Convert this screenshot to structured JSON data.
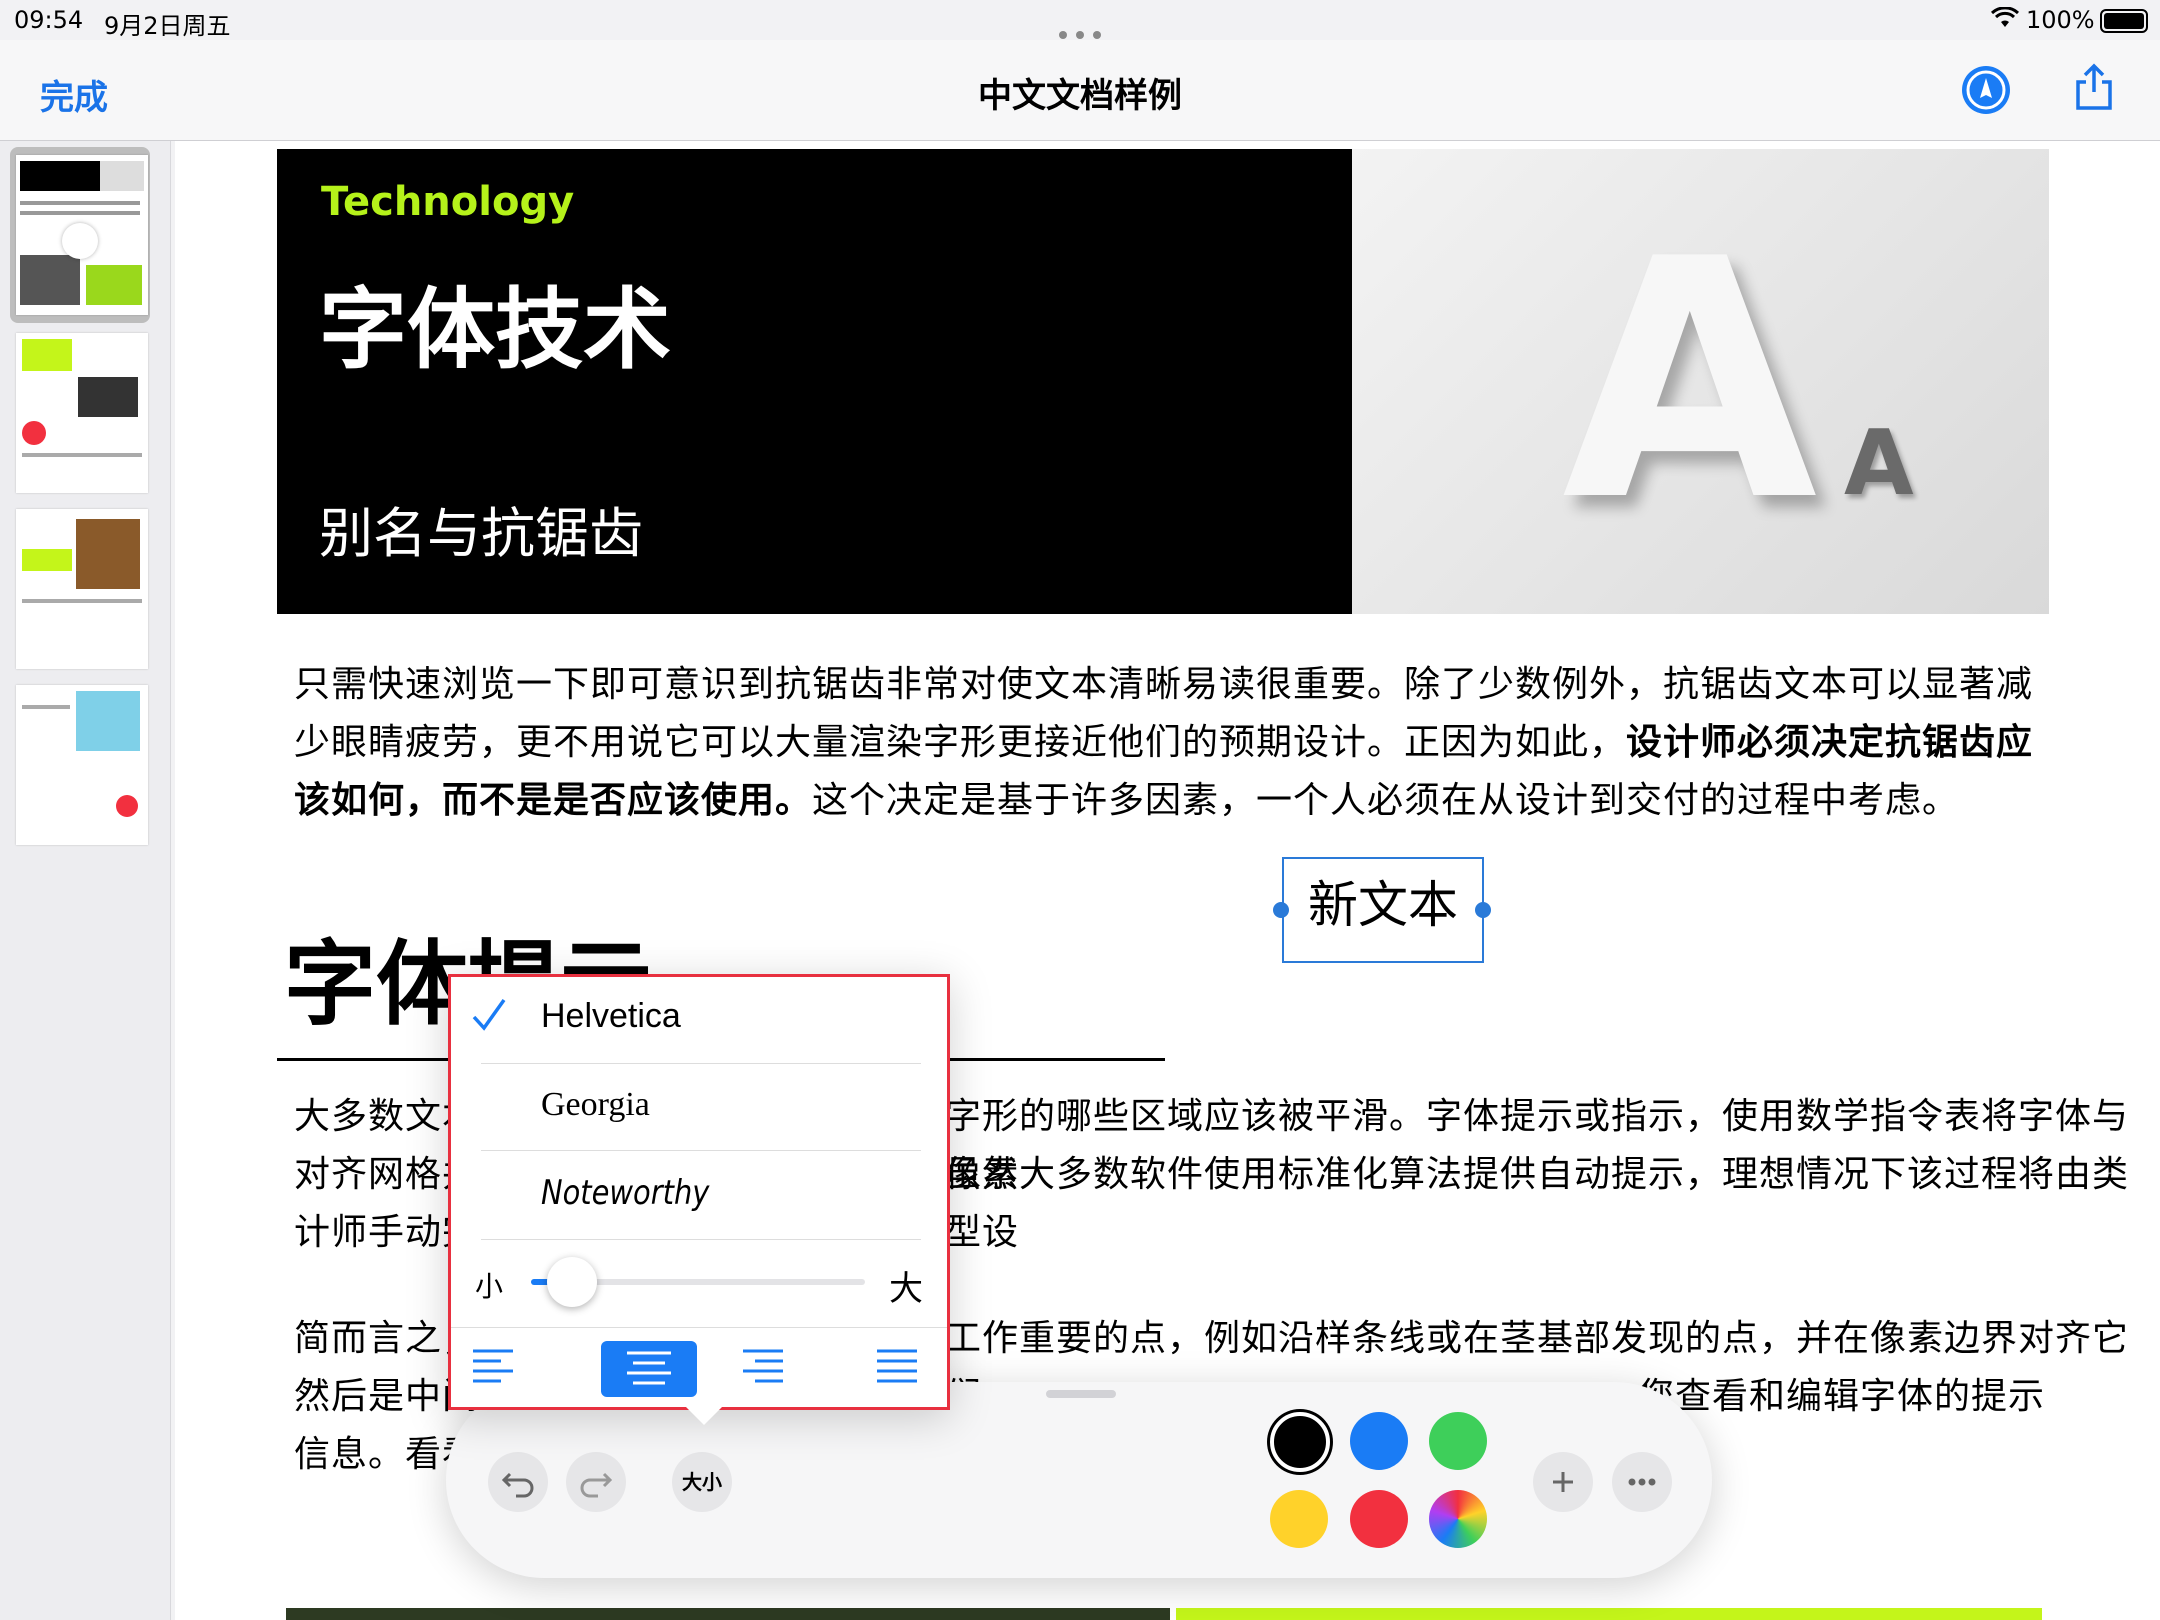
{
  "status": {
    "time": "09:54",
    "date": "9月2日周五",
    "battery": "100%"
  },
  "nav": {
    "done": "完成",
    "title": "中文文档样例"
  },
  "hero": {
    "kicker": "Technology",
    "title": "字体技术",
    "subtitle": "别名与抗锯齿",
    "big_letter": "A",
    "small_letter": "A"
  },
  "doc": {
    "para1_a": "只需快速浏览一下即可意识到抗锯齿非常对使文本清晰易读很重要。除了少数例外，抗锯齿文本可以显著减少眼睛疲劳，更不用说它可以大量渲染字形更接近他们的预期设计。正因为如此，",
    "para1_b": "设计师必须决定抗锯齿应该如何，而不是是否应该使用。",
    "para1_c": "这个决定是基于许多因素，一个人必须在从设计到交付的过程中考虑。",
    "heading": "字体提示",
    "para2_left1": "大多数文本",
    "para2_right1": "字形的哪些区域应该被平滑。字体提示或指示，使用数学指令表将字体与像素",
    "para2_left2": "对齐网格并",
    "para2_right2": "虽然大多数软件使用标准化算法提供自动提示，理想情况下该过程将由类型设",
    "para2_left3": "计师手动完",
    "para3_left1": "简而言之，",
    "para3_right1": "工作重要的点，例如沿样条线或在茎基部发现的点，并在像素边界对齐它们。",
    "para3_left2": "然后是中间",
    "para3_right2": "您查看和编辑字体的提示",
    "para3_left3": "信息。看看"
  },
  "textbox": {
    "text": "新文本"
  },
  "font_popup": {
    "fonts": [
      "Helvetica",
      "Georgia",
      "Noteworthy"
    ],
    "selected": "Helvetica",
    "size_small": "小",
    "size_large": "大",
    "size_level": 0.1,
    "alignments": [
      "left",
      "center",
      "right",
      "justify"
    ],
    "selected_alignment": "center"
  },
  "toolbar": {
    "size_label": "大小",
    "colors": [
      "#000000",
      "#1a7cf5",
      "#3ecf5a",
      "#ffd22a",
      "#f2303f"
    ]
  }
}
